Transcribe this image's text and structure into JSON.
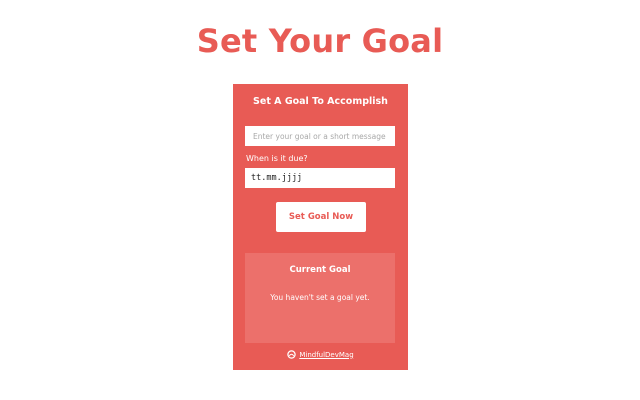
{
  "page": {
    "title": "Set Your Goal"
  },
  "card": {
    "heading": "Set A Goal To Accomplish",
    "goal_input": {
      "value": "",
      "placeholder": "Enter your goal or a short message"
    },
    "due_label": "When is it due?",
    "date_value": "tt.mm.jjjj",
    "button_label": "Set Goal Now",
    "current": {
      "title": "Current Goal",
      "message": "You haven't set a goal yet."
    },
    "footer": {
      "brand": "MindfulDevMag",
      "icon": "brand-logo-icon"
    }
  },
  "colors": {
    "accent": "#e85b55",
    "panel": "#ec706b",
    "background": "#ffffff"
  }
}
